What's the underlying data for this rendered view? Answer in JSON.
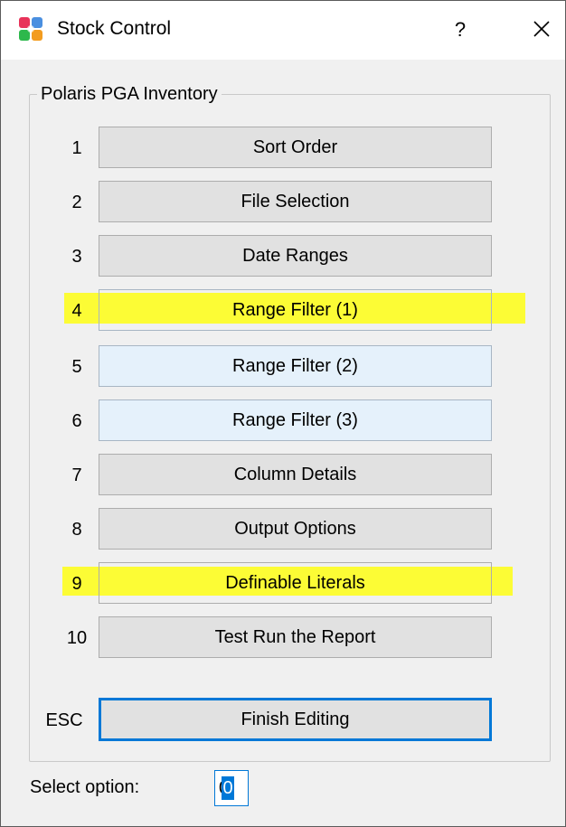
{
  "window": {
    "title": "Stock Control",
    "help_label": "?",
    "icons": {
      "app": "stock-control-app-icon",
      "close": "close-icon"
    }
  },
  "group": {
    "label": "Polaris PGA Inventory"
  },
  "options": [
    {
      "key": "1",
      "label": "Sort Order"
    },
    {
      "key": "2",
      "label": "File Selection"
    },
    {
      "key": "3",
      "label": "Date Ranges"
    },
    {
      "key": "4",
      "label": "Range Filter (1)"
    },
    {
      "key": "5",
      "label": "Range Filter (2)"
    },
    {
      "key": "6",
      "label": "Range Filter (3)"
    },
    {
      "key": "7",
      "label": "Column Details"
    },
    {
      "key": "8",
      "label": "Output Options"
    },
    {
      "key": "9",
      "label": "Definable Literals"
    },
    {
      "key": "10",
      "label": "Test Run the Report"
    }
  ],
  "escape": {
    "key": "ESC",
    "label": "Finish Editing"
  },
  "select": {
    "label": "Select option:",
    "value": "0"
  },
  "colors": {
    "highlight": "#ffff00",
    "accent": "#0078d7"
  }
}
